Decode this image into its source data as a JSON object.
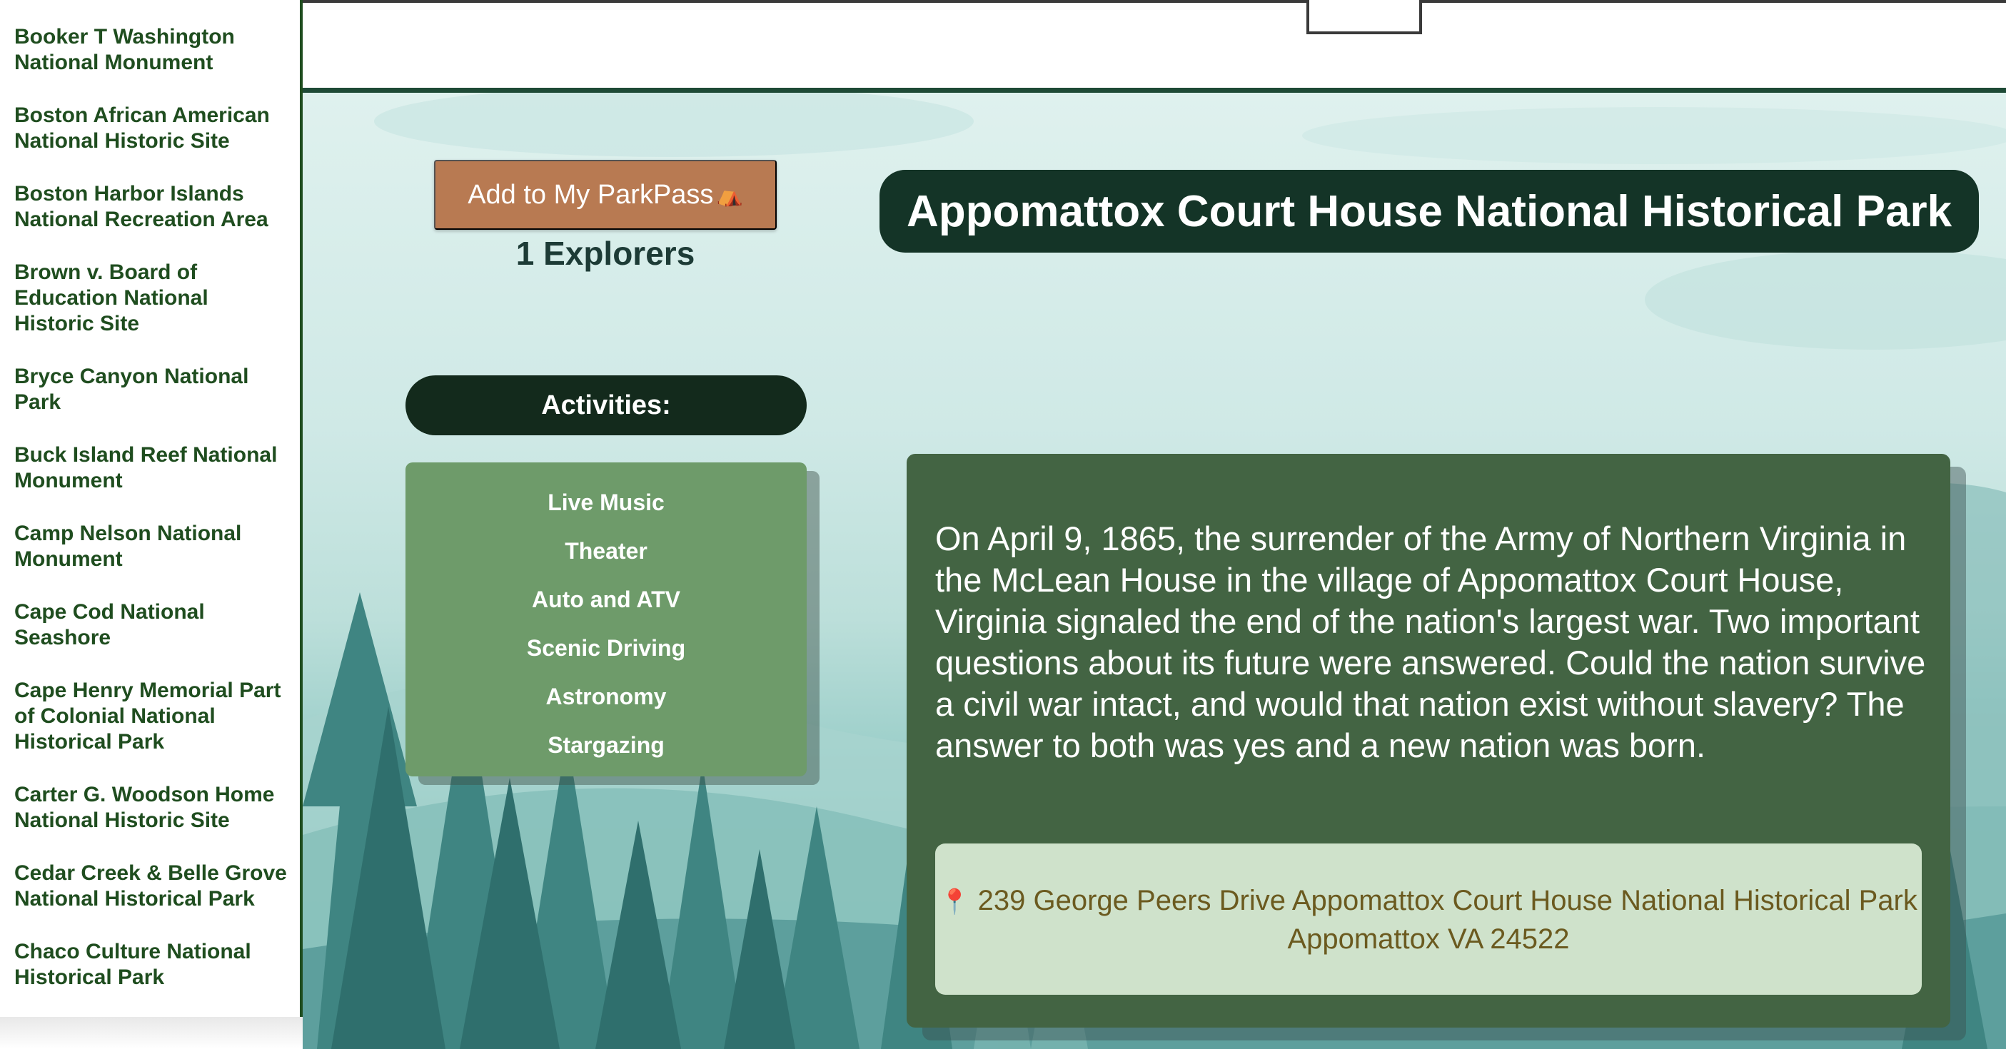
{
  "sidebar": {
    "items": [
      "Booker T Washington National Monument",
      "Boston African American National Historic Site",
      "Boston Harbor Islands National Recreation Area",
      "Brown v. Board of Education National Historic Site",
      "Bryce Canyon National Park",
      "Buck Island Reef National Monument",
      "Camp Nelson National Monument",
      "Cape Cod National Seashore",
      "Cape Henry Memorial Part of Colonial National Historical Park",
      "Carter G. Woodson Home National Historic Site",
      "Cedar Creek & Belle Grove National Historical Park",
      "Chaco Culture National Historical Park"
    ]
  },
  "park": {
    "add_button_label": "Add to My ParkPass",
    "add_button_icon": "⛺",
    "explorers": "1 Explorers",
    "title": "Appomattox Court House National Historical Park",
    "activities_label": "Activities:",
    "activities": [
      "Live Music",
      "Theater",
      "Auto and ATV",
      "Scenic Driving",
      "Astronomy",
      "Stargazing"
    ],
    "description": "On April 9, 1865, the surrender of the Army of Northern Virginia in the McLean House in the village of Appomattox Court House, Virginia signaled the end of the nation's largest war. Two important questions about its future were answered. Could the nation survive a civil war intact, and would that nation exist without slavery? The answer to both was yes and a new nation was born.",
    "address_icon": "📍",
    "address_line1": "239 George Peers Drive Appomattox Court House National Historical Park",
    "address_line2": "Appomattox VA 24522"
  },
  "colors": {
    "sidebar_text": "#1f4d1f",
    "button_brown": "#b87a52",
    "title_bg": "#143427",
    "activities_bg": "#6e9b6a",
    "card_bg": "#436443",
    "address_bg": "#cfe2cb",
    "address_text": "#6b5a1f"
  }
}
